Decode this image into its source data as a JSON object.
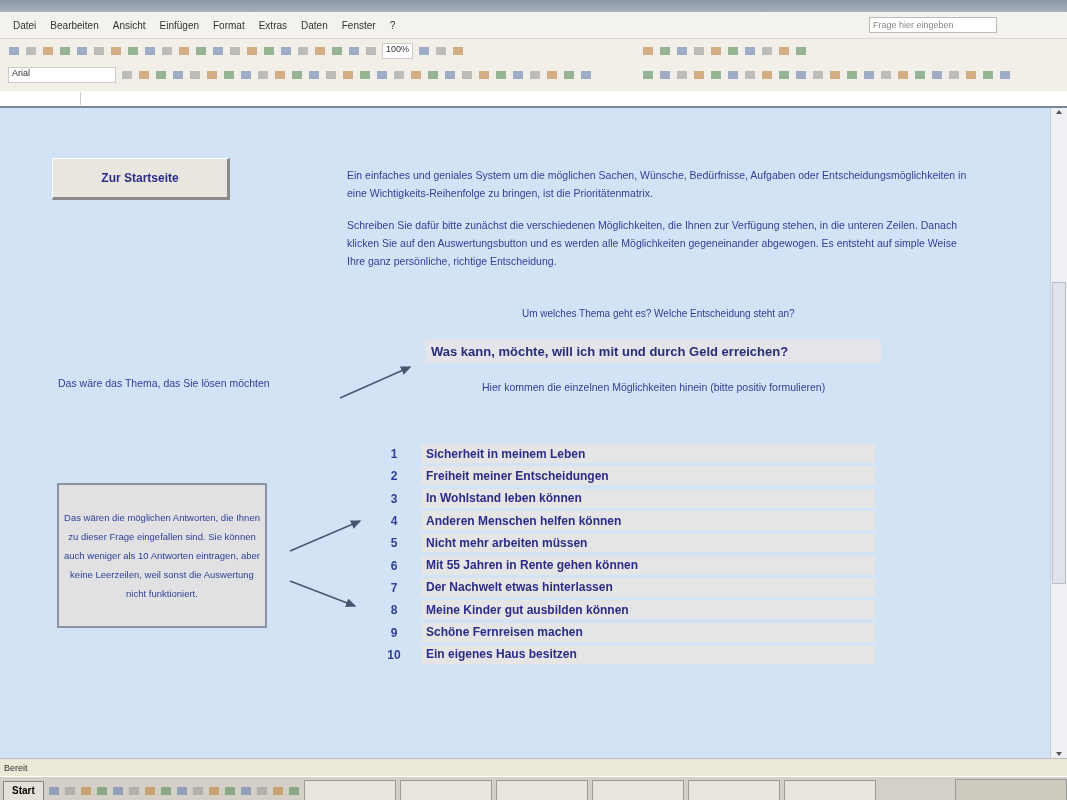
{
  "menu": [
    "Datei",
    "Bearbeiten",
    "Ansicht",
    "Einfügen",
    "Format",
    "Extras",
    "Daten",
    "Fenster",
    "?"
  ],
  "help_box": {
    "placeholder": "Frage hier eingeben"
  },
  "font_box": {
    "value": "Arial"
  },
  "zoom_box": {
    "value": "100%"
  },
  "sheet": {
    "start_button": "Zur Startseite",
    "intro": [
      "Ein einfaches und geniales System um die möglichen Sachen, Wünsche, Bedürfnisse, Aufgaben oder Entscheidungsmöglichkeiten in eine Wichtigkeits-Reihenfolge zu bringen, ist die Prioritätenmatrix.",
      "Schreiben Sie dafür bitte zunächst die verschiedenen Möglichkeiten, die Ihnen zur Verfügung stehen, in die unteren Zeilen. Danach klicken Sie auf den Auswertungsbutton und es werden alle Möglichkeiten gegeneinander abgewogen. Es entsteht auf simple Weise Ihre ganz persönliche, richtige Entscheidung."
    ],
    "topic_prompt": "Um welches Thema geht es?  Welche Entscheidung steht an?",
    "topic": "Was kann, möchte, will ich mit und durch Geld erreichen?",
    "topic_note": "Das wäre das Thema, das Sie lösen möchten",
    "options_prompt": "Hier kommen die einzelnen Möglichkeiten hinein (bitte positiv formulieren)",
    "answers_note": "Das wären die möglichen Antworten, die Ihnen zu dieser Frage eingefallen sind. Sie können auch weniger als 10 Antworten eintragen, aber keine Leerzeilen, weil sonst die Auswertung nicht funktioniert.",
    "options": [
      {
        "number": "1",
        "text": "Sicherheit in meinem Leben"
      },
      {
        "number": "2",
        "text": "Freiheit meiner Entscheidungen"
      },
      {
        "number": "3",
        "text": "In Wohlstand leben können"
      },
      {
        "number": "4",
        "text": "Anderen Menschen helfen können"
      },
      {
        "number": "5",
        "text": "Nicht mehr arbeiten müssen"
      },
      {
        "number": "6",
        "text": "Mit 55 Jahren in Rente gehen können"
      },
      {
        "number": "7",
        "text": "Der Nachwelt etwas hinterlassen"
      },
      {
        "number": "8",
        "text": "Meine Kinder gut ausbilden können"
      },
      {
        "number": "9",
        "text": "Schöne Fernreisen machen"
      },
      {
        "number": "10",
        "text": "Ein eigenes Haus besitzen"
      }
    ]
  },
  "status_bar": "Bereit",
  "taskbar": {
    "start": "Start"
  }
}
